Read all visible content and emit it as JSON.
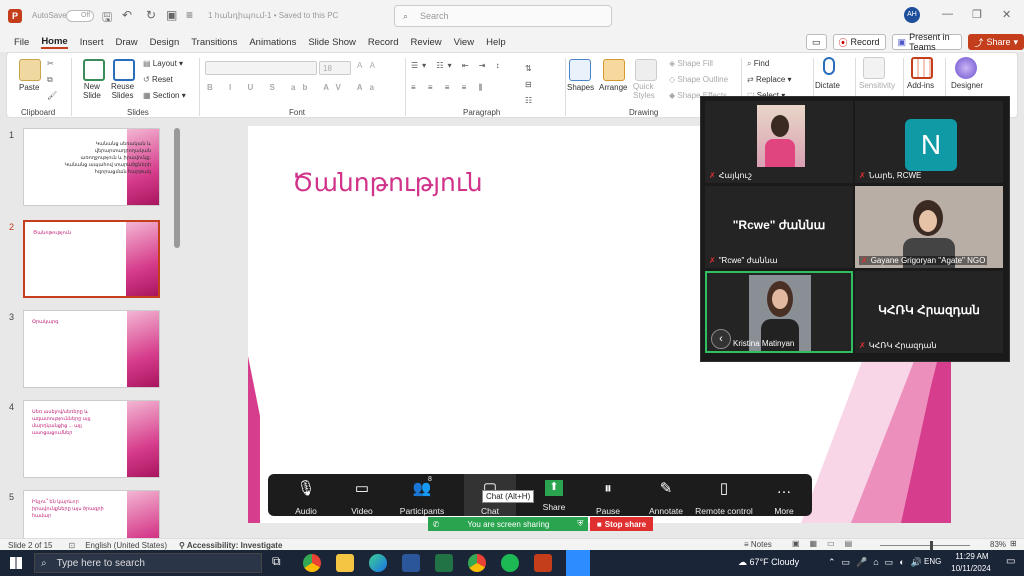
{
  "titlebar": {
    "autosave": "AutoSave",
    "toggle": "Off",
    "doc_title": "1 հանդիպում-1  •  Saved to this PC",
    "search_placeholder": "Search",
    "avatar": "AH"
  },
  "menu": {
    "items": [
      "File",
      "Home",
      "Insert",
      "Draw",
      "Design",
      "Transitions",
      "Animations",
      "Slide Show",
      "Record",
      "Review",
      "View",
      "Help"
    ],
    "active": "Home",
    "record_label": "Record",
    "teams_label": "Present in Teams",
    "share_label": "Share"
  },
  "ribbon": {
    "paste": "Paste",
    "new_slide": "New\nSlide",
    "reuse_slides": "Reuse\nSlides",
    "layout": "Layout",
    "reset": "Reset",
    "section": "Section",
    "font_size": "18",
    "shapes": "Shapes",
    "arrange": "Arrange",
    "quick_styles": "Quick\nStyles",
    "shape_fill": "Shape Fill",
    "shape_outline": "Shape Outline",
    "shape_effects": "Shape Effects",
    "find": "Find",
    "replace": "Replace",
    "select": "Select",
    "dictate": "Dictate",
    "sensitivity": "Sensitivity",
    "addins": "Add-ins",
    "designer": "Designer",
    "groups": {
      "clipboard": "Clipboard",
      "slides": "Slides",
      "font": "Font",
      "paragraph": "Paragraph",
      "drawing": "Drawing"
    }
  },
  "thumbs": [
    {
      "num": "1",
      "text": "Կանանց սեռական և վերարտադրողական առողջություն և իրավունք. Կանանց ապահով տարածքների հզորացման հարթակ"
    },
    {
      "num": "2",
      "text": "Ծանոթություն"
    },
    {
      "num": "3",
      "text": "Օրակարգ"
    },
    {
      "num": "4",
      "text": "Սեռ ասելով/սեռերը և ազատությունները այլ մարդկանցից ... այլ ասոցացումներ"
    },
    {
      "num": "5",
      "text": "Ինչու՞ են կարևոր իրավունքները այս ծրագրի համար"
    }
  ],
  "slide": {
    "title": "Ծանոթություն"
  },
  "gallery": [
    {
      "name": "Հայկուշ",
      "type": "video"
    },
    {
      "name": "Նարե, RCWE",
      "type": "avatar",
      "letter": "N"
    },
    {
      "name": "\"Rcwe\" ժաննա",
      "type": "text",
      "big": "\"Rcwe\" ժաննա"
    },
    {
      "name": "Gayane Grigoryan \"Agate\" NGO",
      "type": "video"
    },
    {
      "name": "Kristina Matinyan",
      "type": "video"
    },
    {
      "name": "ԿՀՌԿ Հրազդան",
      "type": "text",
      "big": "ԿՀՌԿ Հրազդան"
    }
  ],
  "zoom": {
    "buttons": [
      {
        "icon": "microphone-icon",
        "label": "Audio",
        "glyph": "🎙"
      },
      {
        "icon": "camera-icon",
        "label": "Video",
        "glyph": "▭"
      },
      {
        "icon": "participants-icon",
        "label": "Participants",
        "glyph": "👥",
        "count": "8"
      },
      {
        "icon": "chat-icon",
        "label": "Chat",
        "glyph": "▢"
      },
      {
        "icon": "share-screen-icon",
        "label": "Share",
        "glyph": "⬆"
      },
      {
        "icon": "pause-icon",
        "label": "Pause",
        "glyph": "⏸"
      },
      {
        "icon": "annotate-icon",
        "label": "Annotate",
        "glyph": "✎"
      },
      {
        "icon": "remote-control-icon",
        "label": "Remote control",
        "glyph": "▯"
      },
      {
        "icon": "more-icon",
        "label": "More",
        "glyph": "…"
      }
    ],
    "tooltip": "Chat (Alt+H)",
    "sharing": "You are screen sharing",
    "stop_share": "Stop share"
  },
  "status": {
    "slide": "Slide 2 of 15",
    "language": "English (United States)",
    "accessibility": "Accessibility: Investigate",
    "notes": "Notes",
    "zoom": "83%"
  },
  "taskbar": {
    "search": "Type here to search",
    "weather": "67°F  Cloudy",
    "lang": "ENG",
    "time": "11:29 AM",
    "date": "10/11/2024"
  },
  "colors": {
    "accent": "#c43e1c",
    "slide_pink": "#d1338a",
    "zoom_green": "#2aa44f",
    "stop_red": "#e02f2f"
  }
}
